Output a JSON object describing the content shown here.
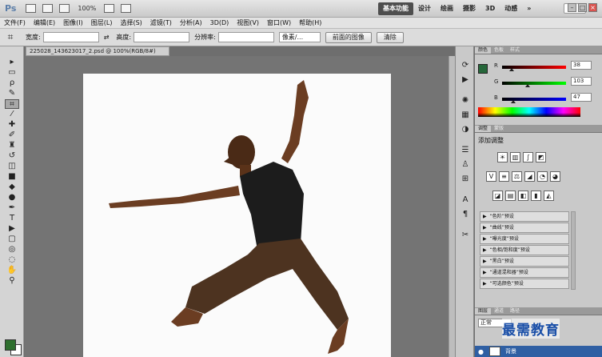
{
  "titlebar": {
    "app_logo": "Ps",
    "zoom": "100%",
    "workspaces": [
      "基本功能",
      "设计",
      "绘画",
      "摄影",
      "3D",
      "动感",
      "»"
    ]
  },
  "menu": [
    "文件(F)",
    "编辑(E)",
    "图像(I)",
    "图层(L)",
    "选择(S)",
    "滤镜(T)",
    "分析(A)",
    "3D(D)",
    "视图(V)",
    "窗口(W)",
    "帮助(H)"
  ],
  "options": {
    "width_label": "宽度:",
    "height_label": "高度:",
    "resolution_label": "分辨率:",
    "unit_select": "像素/...",
    "front_image_button": "前面的图像",
    "clear_button": "清除"
  },
  "document": {
    "tab_title": "225028_143623017_2.psd @ 100%(RGB/8#)"
  },
  "panels": {
    "color_tabs": [
      "颜色",
      "色板",
      "样式"
    ],
    "color_channels": [
      {
        "label": "R",
        "value": "38",
        "level": 0.15,
        "gradient": "#ff0000"
      },
      {
        "label": "G",
        "value": "103",
        "level": 0.4,
        "gradient": "#00ff00"
      },
      {
        "label": "B",
        "value": "47",
        "level": 0.18,
        "gradient": "#0000ff"
      }
    ],
    "adjust_tabs": [
      "调整",
      "蒙版"
    ],
    "adjust_title": "添加调整",
    "presets": [
      "“色阶”预设",
      "“曲线”预设",
      "“曝光度”预设",
      "“色相/饱和度”预设",
      "“黑白”预设",
      "“通道混和器”预设",
      "“可选颜色”预设"
    ],
    "layer_tabs": [
      "图层",
      "通道",
      "路径"
    ],
    "blend_mode": "正常",
    "layer_name": "背景"
  },
  "watermark": "最需教育",
  "colors": {
    "foreground": "#26673a",
    "accent_selection": "#2f5fa3"
  }
}
